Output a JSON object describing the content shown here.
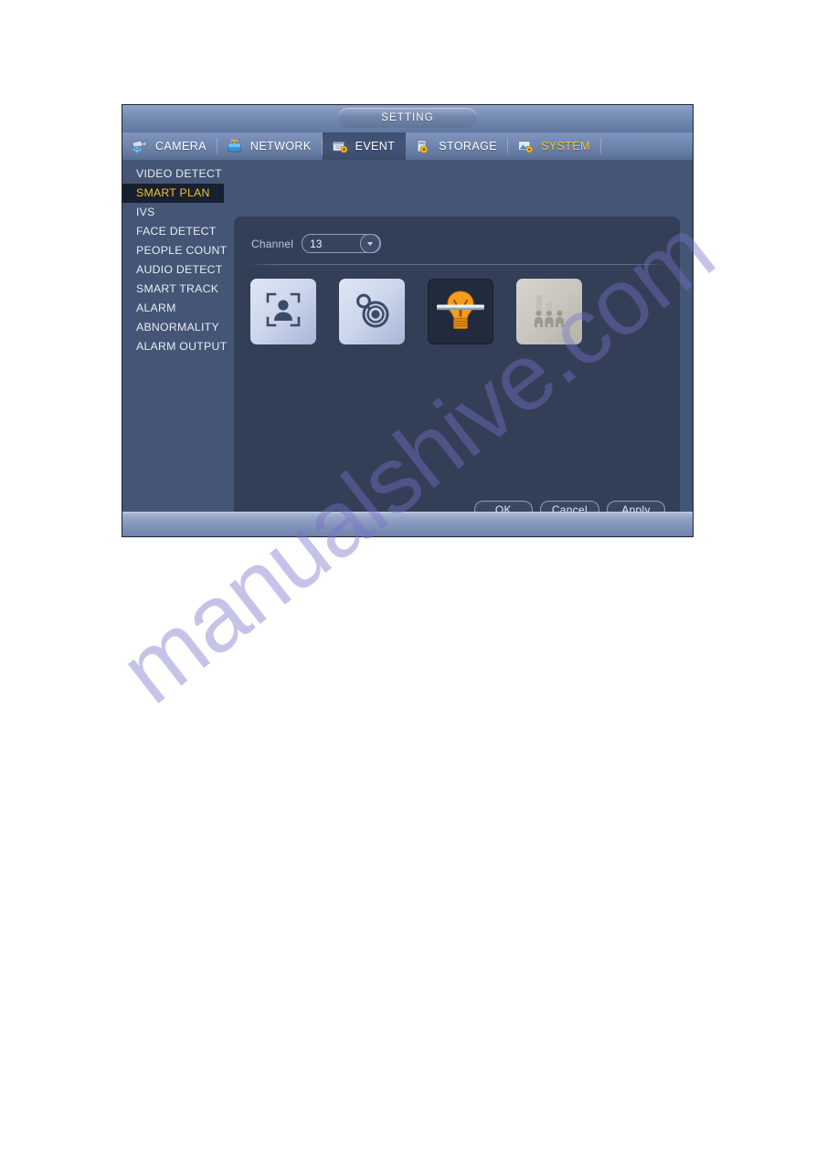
{
  "window": {
    "title": "SETTING"
  },
  "tabs": [
    {
      "label": "CAMERA",
      "icon": "camera-icon",
      "active": false,
      "accent": false
    },
    {
      "label": "NETWORK",
      "icon": "network-icon",
      "active": false,
      "accent": false
    },
    {
      "label": "EVENT",
      "icon": "event-icon",
      "active": true,
      "accent": false
    },
    {
      "label": "STORAGE",
      "icon": "storage-icon",
      "active": false,
      "accent": false
    },
    {
      "label": "SYSTEM",
      "icon": "system-icon",
      "active": false,
      "accent": true
    }
  ],
  "sidebar": {
    "items": [
      {
        "label": "VIDEO DETECT",
        "selected": false
      },
      {
        "label": "SMART PLAN",
        "selected": true
      },
      {
        "label": "IVS",
        "selected": false
      },
      {
        "label": "FACE DETECT",
        "selected": false
      },
      {
        "label": "PEOPLE COUNT",
        "selected": false
      },
      {
        "label": "AUDIO DETECT",
        "selected": false
      },
      {
        "label": "SMART TRACK",
        "selected": false
      },
      {
        "label": "ALARM",
        "selected": false
      },
      {
        "label": "ABNORMALITY",
        "selected": false
      },
      {
        "label": "ALARM OUTPUT",
        "selected": false
      }
    ]
  },
  "main": {
    "channel": {
      "label": "Channel",
      "value": "13",
      "options": [
        "13"
      ]
    },
    "tiles": [
      {
        "icon": "face-detect-icon",
        "state": "normal"
      },
      {
        "icon": "heat-map-icon",
        "state": "normal"
      },
      {
        "icon": "ivs-tripwire-icon",
        "state": "selected"
      },
      {
        "icon": "people-count-icon",
        "state": "disabled"
      }
    ]
  },
  "buttons": {
    "ok": "OK",
    "cancel": "Cancel",
    "apply": "Apply"
  },
  "watermark": {
    "text": "manualshive.com"
  },
  "colors": {
    "accent_yellow": "#f5c22b",
    "selected_tile_bg": "#222b3d",
    "panel_bg": "#323f57",
    "sidebar_bg": "#455575",
    "bulb_orange": "#f49a1e"
  }
}
